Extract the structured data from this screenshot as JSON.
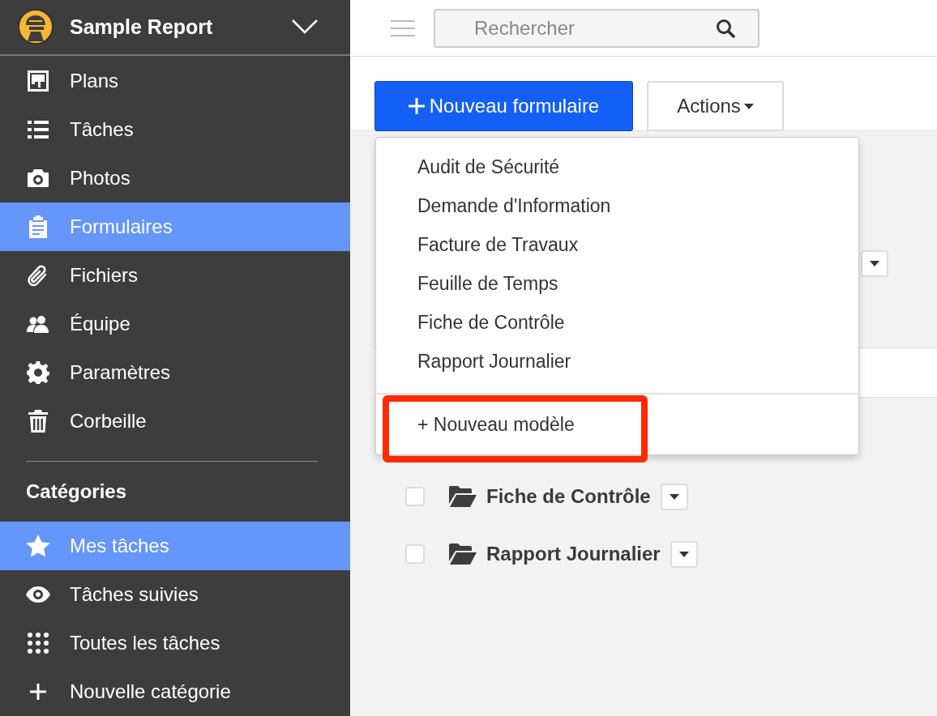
{
  "app": {
    "project_name": "Sample Report"
  },
  "sidebar": {
    "items": [
      {
        "label": "Plans",
        "selected": false
      },
      {
        "label": "Tâches",
        "selected": false
      },
      {
        "label": "Photos",
        "selected": false
      },
      {
        "label": "Formulaires",
        "selected": true
      },
      {
        "label": "Fichiers",
        "selected": false
      },
      {
        "label": "Équipe",
        "selected": false
      },
      {
        "label": "Paramètres",
        "selected": false
      },
      {
        "label": "Corbeille",
        "selected": false
      }
    ],
    "categories_heading": "Catégories",
    "categories": [
      {
        "label": "Mes tâches",
        "selected": true
      },
      {
        "label": "Tâches suivies",
        "selected": false
      },
      {
        "label": "Toutes les tâches",
        "selected": false
      },
      {
        "label": "Nouvelle catégorie",
        "selected": false
      }
    ]
  },
  "search": {
    "placeholder": "Rechercher"
  },
  "toolbar": {
    "new_button": "Nouveau formulaire",
    "actions_button": "Actions"
  },
  "dropdown": {
    "items": [
      "Audit de Sécurité",
      "Demande d'Information",
      "Facture de Travaux",
      "Feuille de Temps",
      "Fiche de Contrôle",
      "Rapport Journalier"
    ],
    "footer_item": "+ Nouveau modèle",
    "highlighted": true
  },
  "folders": [
    {
      "name": "Fiche de Contrôle",
      "checked": false
    },
    {
      "name": "Rapport Journalier",
      "checked": false
    }
  ]
}
